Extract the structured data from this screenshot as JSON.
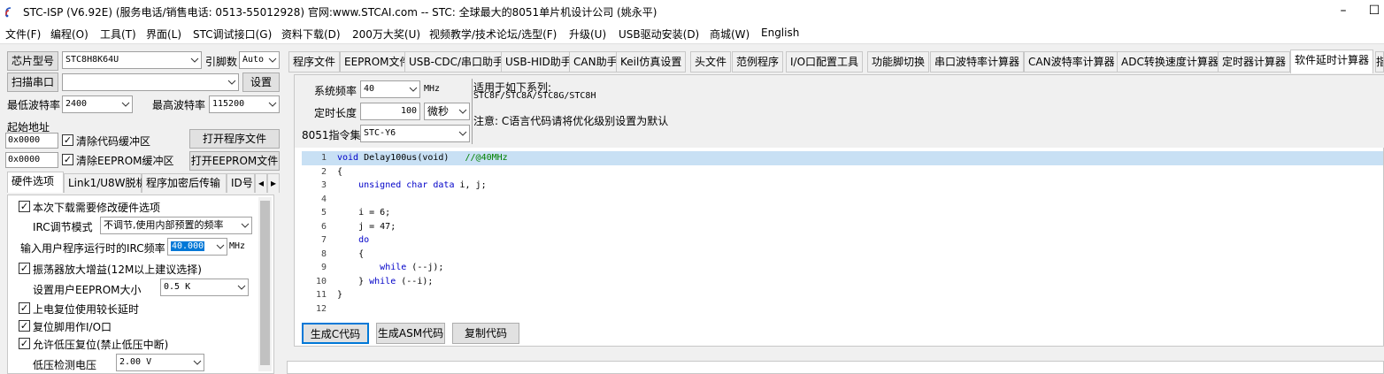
{
  "titlebar": {
    "title": "STC-ISP (V6.92E) (服务电话/销售电话: 0513-55012928) 官网:www.STCAI.com  -- STC: 全球最大的8051单片机设计公司 (姚永平)",
    "minimize": "–",
    "maximize": "☐"
  },
  "menu": [
    "文件(F)",
    "编程(O)",
    "工具(T)",
    "界面(L)",
    "STC调试接口(G)",
    "资料下载(D)",
    "200万大奖(U)",
    "视频教学/技术论坛/选型(F)",
    "升级(U)",
    "USB驱动安装(D)",
    "商城(W)",
    "English"
  ],
  "left": {
    "chip_label": "芯片型号",
    "chip_value": "STC8H8K64U",
    "pins_label": "引脚数",
    "pins_value": "Auto",
    "scan_button": "扫描串口",
    "port_value": "",
    "settings_button": "设置",
    "min_baud_label": "最低波特率",
    "min_baud_value": "2400",
    "max_baud_label": "最高波特率",
    "max_baud_value": "115200",
    "start_addr_label": "起始地址",
    "addr1": "0x0000",
    "clear_code_label": "清除代码缓冲区",
    "open_prog_button": "打开程序文件",
    "addr2": "0x0000",
    "clear_eeprom_label": "清除EEPROM缓冲区",
    "open_eeprom_button": "打开EEPROM文件",
    "tabs": [
      "硬件选项",
      "Link1/U8W脱机",
      "程序加密后传输",
      "ID号"
    ],
    "hw": {
      "modify_hw": "本次下载需要修改硬件选项",
      "irc_mode_label": "IRC调节模式",
      "irc_mode_value": "不调节,使用内部预置的频率",
      "irc_freq_label": "输入用户程序运行时的IRC频率",
      "irc_freq_value": "40.000",
      "irc_freq_unit": "MHz",
      "osc_gain": "振荡器放大增益(12M以上建议选择)",
      "eeprom_size_label": "设置用户EEPROM大小",
      "eeprom_size_value": "0.5 K",
      "por_delay": "上电复位使用较长延时",
      "reset_pin_io": "复位脚用作I/O口",
      "lvr": "允许低压复位(禁止低压中断)",
      "lvd_label": "低压检测电压",
      "lvd_value": "2.00 V"
    }
  },
  "right": {
    "tabs": [
      "程序文件",
      "EEPROM文件",
      "USB-CDC/串口助手",
      "USB-HID助手",
      "CAN助手",
      "Keil仿真设置",
      "头文件",
      "范例程序",
      "I/O口配置工具",
      "功能脚切换",
      "串口波特率计算器",
      "CAN波特率计算器",
      "ADC转换速度计算器",
      "定时器计算器",
      "软件延时计算器",
      "指"
    ],
    "form": {
      "sys_freq_label": "系统频率",
      "sys_freq_value": "40",
      "sys_freq_unit": "MHz",
      "delay_len_label": "定时长度",
      "delay_len_value": "100",
      "delay_unit": "微秒",
      "isa_label": "8051指令集",
      "isa_value": "STC-Y6",
      "series_title": "适用于如下系列:",
      "series_list": "STC8F/STC8A/STC8G/STC8H",
      "note": "注意: C语言代码请将优化级别设置为默认"
    },
    "code_lines": [
      {
        "n": "1",
        "parts": [
          [
            "kw",
            "void"
          ],
          [
            "",
            " Delay100us(void)   "
          ],
          [
            "cm",
            "//@40MHz"
          ]
        ]
      },
      {
        "n": "2",
        "parts": [
          [
            "",
            "{"
          ]
        ]
      },
      {
        "n": "3",
        "parts": [
          [
            "",
            "    "
          ],
          [
            "kw",
            "unsigned char data"
          ],
          [
            "",
            " i, j;"
          ]
        ]
      },
      {
        "n": "4",
        "parts": [
          [
            "",
            ""
          ]
        ]
      },
      {
        "n": "5",
        "parts": [
          [
            "",
            "    i = 6;"
          ]
        ]
      },
      {
        "n": "6",
        "parts": [
          [
            "",
            "    j = 47;"
          ]
        ]
      },
      {
        "n": "7",
        "parts": [
          [
            "",
            "    "
          ],
          [
            "kw",
            "do"
          ]
        ]
      },
      {
        "n": "8",
        "parts": [
          [
            "",
            "    {"
          ]
        ]
      },
      {
        "n": "9",
        "parts": [
          [
            "",
            "        "
          ],
          [
            "kw",
            "while"
          ],
          [
            "",
            " (--j);"
          ]
        ]
      },
      {
        "n": "10",
        "parts": [
          [
            "",
            "    } "
          ],
          [
            "kw",
            "while"
          ],
          [
            "",
            " (--i);"
          ]
        ]
      },
      {
        "n": "11",
        "parts": [
          [
            "",
            "}"
          ]
        ]
      },
      {
        "n": "12",
        "parts": [
          [
            "",
            ""
          ]
        ]
      }
    ],
    "gen_c_button": "生成C代码",
    "gen_asm_button": "生成ASM代码",
    "copy_button": "复制代码"
  }
}
